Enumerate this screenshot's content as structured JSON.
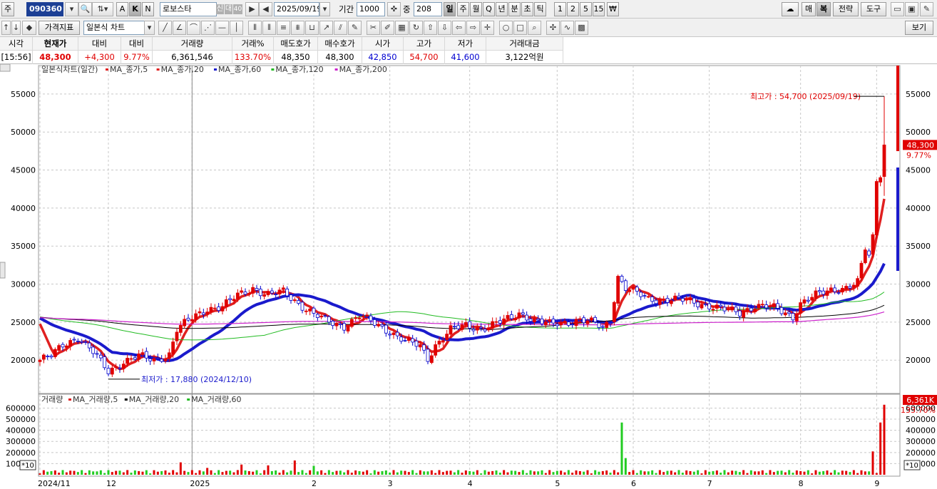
{
  "toolbar1": {
    "market_label": "주",
    "code": "090360",
    "k_buttons": [
      "A",
      "K",
      "N"
    ],
    "stock_name": "로보스타",
    "tag1": "신",
    "tag2": "대",
    "tag3": "40",
    "date": "2025/09/19",
    "period_label": "기간",
    "period_value": "1000",
    "count_label": "중",
    "count_value": "208",
    "intervals": [
      "일",
      "주",
      "월",
      "Q",
      "년",
      "분",
      "초",
      "틱",
      "1",
      "2",
      "5",
      "15",
      "₩"
    ],
    "right_buttons": [
      "매",
      "복",
      "전략",
      "도구"
    ]
  },
  "toolbar2": {
    "indicator_button": "가격지표",
    "chart_type": "일본식 차트",
    "view_button": "보기"
  },
  "quote": {
    "headers": [
      "시각",
      "현재가",
      "대비",
      "대비",
      "거래량",
      "거래%",
      "매도호가",
      "매수호가",
      "시가",
      "고가",
      "저가",
      "거래대금"
    ],
    "values": [
      "[15:56]",
      "48,300",
      "+4,300",
      "9.77%",
      "6,361,546",
      "133.70%",
      "48,350",
      "48,300",
      "42,850",
      "54,700",
      "41,600",
      "3,122억원"
    ]
  },
  "legend": {
    "title": "일본식차트(일간)",
    "items": [
      {
        "label": "MA_종가,5",
        "color": "#e02020"
      },
      {
        "label": "MA_종가,20",
        "color": "#e02020"
      },
      {
        "label": "MA_종가,60",
        "color": "#1a1acc"
      },
      {
        "label": "MA_종가,120",
        "color": "#22bb22"
      },
      {
        "label": "MA_종가,200",
        "color": "#cc22cc"
      }
    ]
  },
  "volume_legend": {
    "title": "거래량",
    "items": [
      {
        "label": "MA_거래량,5",
        "color": "#e02020"
      },
      {
        "label": "MA_거래량,20",
        "color": "#000000"
      },
      {
        "label": "MA_거래량,60",
        "color": "#22bb22"
      }
    ]
  },
  "annotations": {
    "high": "최고가 : 54,700 (2025/09/19)",
    "low": "최저가 : 17,880 (2024/12/10)",
    "price_tag": "48,300",
    "price_pct": "9.77%",
    "volume_tag": "6,361K",
    "volume_pct": "133.70%",
    "scale_badge": "*10"
  },
  "chart_data": {
    "type": "candlestick",
    "price_axis": {
      "ylim": [
        15800,
        57800
      ],
      "ticks": [
        20000,
        25000,
        30000,
        35000,
        40000,
        45000,
        50000,
        55000
      ],
      "tick_labels": [
        "20000",
        "25000",
        "30000",
        "35000",
        "40000",
        "45000",
        "50000",
        "55000"
      ]
    },
    "volume_axis": {
      "ylim": [
        0,
        680000
      ],
      "ticks": [
        100000,
        200000,
        300000,
        400000,
        500000,
        600000
      ],
      "tick_labels": [
        "100000",
        "200000",
        "300000",
        "400000",
        "500000",
        "600000"
      ]
    },
    "x_axis_labels": [
      {
        "label": "2024/11",
        "day": 0
      },
      {
        "label": "12",
        "day": 18
      },
      {
        "label": "2025",
        "day": 40
      },
      {
        "label": "2",
        "day": 72
      },
      {
        "label": "3",
        "day": 92
      },
      {
        "label": "4",
        "day": 113
      },
      {
        "label": "5",
        "day": 136
      },
      {
        "label": "6",
        "day": 156
      },
      {
        "label": "7",
        "day": 176
      },
      {
        "label": "8",
        "day": 200
      },
      {
        "label": "9",
        "day": 220
      }
    ],
    "close_anchors": [
      [
        0,
        20000
      ],
      [
        3,
        20500
      ],
      [
        6,
        22000
      ],
      [
        10,
        23000
      ],
      [
        14,
        21000
      ],
      [
        18,
        18500
      ],
      [
        22,
        19800
      ],
      [
        26,
        20500
      ],
      [
        30,
        20000
      ],
      [
        34,
        20800
      ],
      [
        36,
        24000
      ],
      [
        40,
        25500
      ],
      [
        44,
        26800
      ],
      [
        48,
        27000
      ],
      [
        52,
        28500
      ],
      [
        56,
        29500
      ],
      [
        60,
        28500
      ],
      [
        64,
        29000
      ],
      [
        68,
        27500
      ],
      [
        72,
        26000
      ],
      [
        76,
        25000
      ],
      [
        80,
        24500
      ],
      [
        84,
        25800
      ],
      [
        88,
        24800
      ],
      [
        92,
        23800
      ],
      [
        96,
        22500
      ],
      [
        100,
        21800
      ],
      [
        102,
        20200
      ],
      [
        104,
        22000
      ],
      [
        108,
        24000
      ],
      [
        112,
        24500
      ],
      [
        116,
        24200
      ],
      [
        120,
        24800
      ],
      [
        124,
        25500
      ],
      [
        126,
        26200
      ],
      [
        128,
        25800
      ],
      [
        130,
        25200
      ],
      [
        134,
        24700
      ],
      [
        138,
        25000
      ],
      [
        142,
        25300
      ],
      [
        146,
        24800
      ],
      [
        148,
        24200
      ],
      [
        150,
        25300
      ],
      [
        152,
        31000
      ],
      [
        154,
        29500
      ],
      [
        156,
        29000
      ],
      [
        160,
        28000
      ],
      [
        166,
        28000
      ],
      [
        170,
        27800
      ],
      [
        176,
        27200
      ],
      [
        180,
        26600
      ],
      [
        184,
        26200
      ],
      [
        188,
        27200
      ],
      [
        192,
        27000
      ],
      [
        196,
        26200
      ],
      [
        198,
        25700
      ],
      [
        200,
        27500
      ],
      [
        204,
        28500
      ],
      [
        208,
        29200
      ],
      [
        212,
        29600
      ],
      [
        215,
        30200
      ],
      [
        217,
        34500
      ],
      [
        218,
        33800
      ],
      [
        219,
        36500
      ],
      [
        220,
        43500
      ],
      [
        221,
        44000
      ],
      [
        222,
        48300
      ]
    ],
    "ma_series": [
      {
        "name": "MA_종가,5",
        "color": "#e02020",
        "period": 5
      },
      {
        "name": "MA_종가,20",
        "color": "#1a1acc",
        "period": 20
      },
      {
        "name": "MA_종가,60",
        "color": "#22bb22",
        "period": 60
      },
      {
        "name": "MA_종가,120",
        "color": "#000000",
        "period": 120
      },
      {
        "name": "MA_종가,200",
        "color": "#cc22cc",
        "period": 200
      }
    ],
    "volume_spikes": [
      {
        "day": 153,
        "value": 470000
      },
      {
        "day": 154,
        "value": 150000
      },
      {
        "day": 219,
        "value": 210000
      },
      {
        "day": 221,
        "value": 470000
      },
      {
        "day": 222,
        "value": 630000
      }
    ],
    "high": {
      "value": 54700,
      "day": 222
    },
    "low": {
      "value": 17880,
      "day": 18
    },
    "current": 48300
  }
}
